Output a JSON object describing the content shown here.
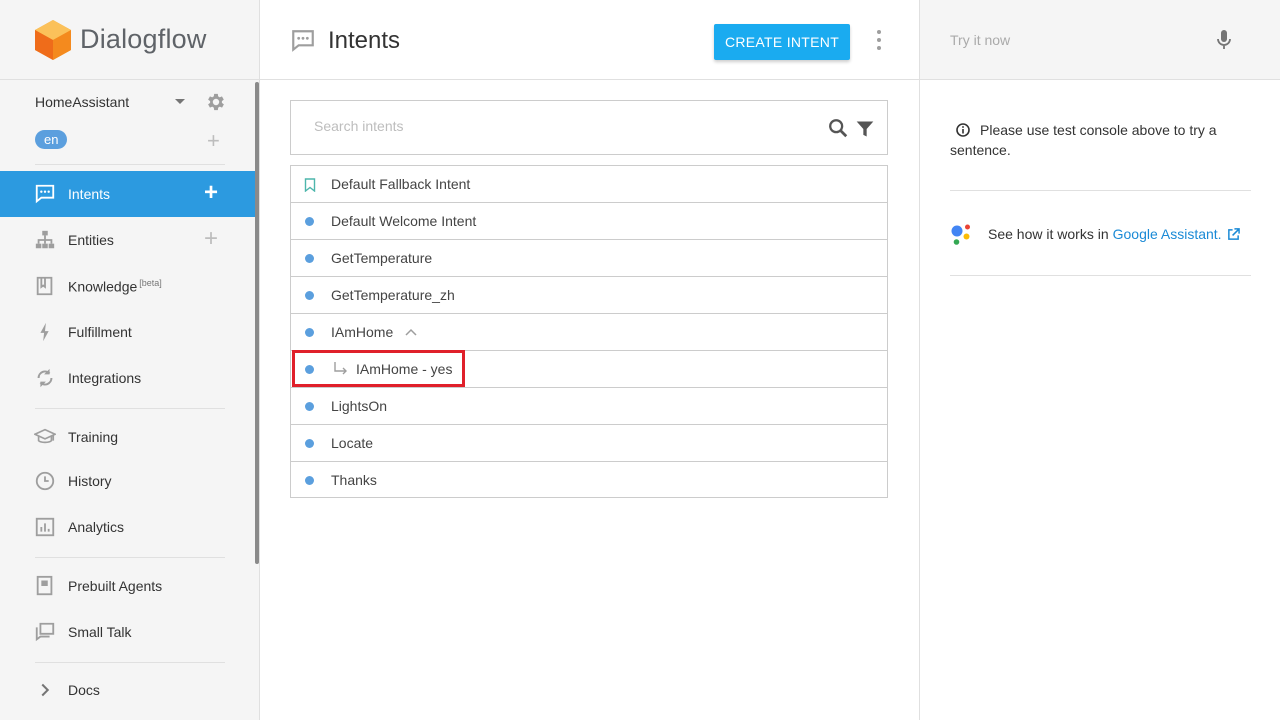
{
  "brand": {
    "name": "Dialogflow"
  },
  "agent": {
    "name": "HomeAssistant",
    "language": "en"
  },
  "nav": {
    "intents": "Intents",
    "entities": "Entities",
    "knowledge": "Knowledge",
    "knowledge_badge": "[beta]",
    "fulfillment": "Fulfillment",
    "integrations": "Integrations",
    "training": "Training",
    "history": "History",
    "analytics": "Analytics",
    "prebuilt_agents": "Prebuilt Agents",
    "small_talk": "Small Talk",
    "docs": "Docs"
  },
  "header": {
    "title": "Intents",
    "create_button": "CREATE INTENT"
  },
  "search": {
    "placeholder": "Search intents"
  },
  "intents": [
    {
      "name": "Default Fallback Intent"
    },
    {
      "name": "Default Welcome Intent"
    },
    {
      "name": "GetTemperature"
    },
    {
      "name": "GetTemperature_zh"
    },
    {
      "name": "IAmHome"
    },
    {
      "name": "IAmHome - yes"
    },
    {
      "name": "LightsOn"
    },
    {
      "name": "Locate"
    },
    {
      "name": "Thanks"
    }
  ],
  "right_panel": {
    "try_placeholder": "Try it now",
    "info_text": "Please use test console above to try a sentence.",
    "assistant_text": "See how it works in",
    "assistant_link": "Google Assistant."
  },
  "colors": {
    "accent": "#2c9ae0",
    "button": "#1aabf0",
    "highlight": "#e0202a",
    "dot": "#5b9fde"
  }
}
